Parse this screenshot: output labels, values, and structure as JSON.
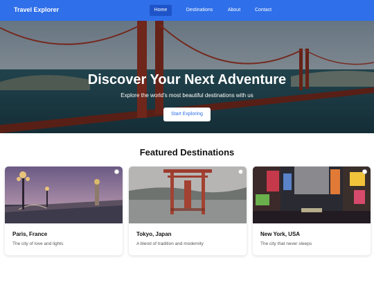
{
  "nav": {
    "brand": "Travel Explorer",
    "links": [
      "Home",
      "Destinations",
      "About",
      "Contact"
    ],
    "active": "Home",
    "color": "#2f6fe9"
  },
  "hero": {
    "title": "Discover Your Next Adventure",
    "subtitle": "Explore the world's most beautiful destinations with us",
    "button": "Start Exploring"
  },
  "featured": {
    "title": "Featured Destinations",
    "cards": [
      {
        "title": "Paris, France",
        "desc": "The city of love and lights",
        "image": "paris-bridge-photo"
      },
      {
        "title": "Tokyo, Japan",
        "desc": "A blend of tradition and modernity",
        "image": "torii-gate-photo"
      },
      {
        "title": "New York, USA",
        "desc": "The city that never sleeps",
        "image": "times-square-photo"
      }
    ]
  }
}
